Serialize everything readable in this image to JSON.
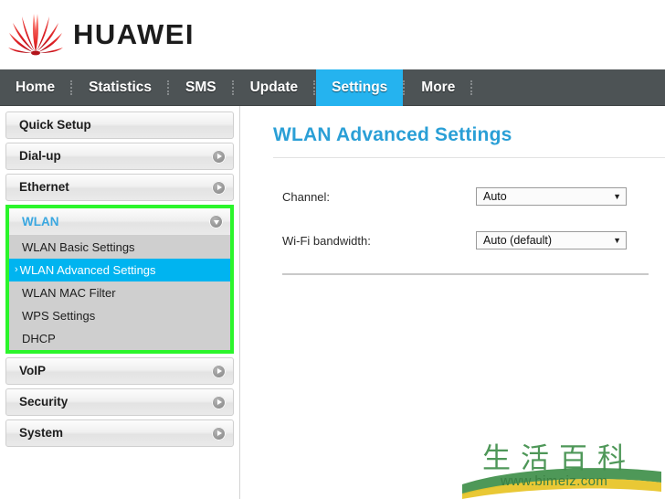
{
  "brand": {
    "name": "HUAWEI",
    "logo_icon": "huawei-flower-logo",
    "logo_color": "#e0131a"
  },
  "nav": {
    "active": "Settings",
    "active_color": "#25b3ef",
    "items": [
      {
        "label": "Home",
        "active": false
      },
      {
        "label": "Statistics",
        "active": false
      },
      {
        "label": "SMS",
        "active": false
      },
      {
        "label": "Update",
        "active": false
      },
      {
        "label": "Settings",
        "active": true
      },
      {
        "label": "More",
        "active": false
      }
    ]
  },
  "sidebar": {
    "highlight_color": "#2bf52b",
    "selected_color": "#00b4f0",
    "items": [
      {
        "label": "Quick Setup",
        "icon": null
      },
      {
        "label": "Dial-up",
        "icon": "chevron-right-icon"
      },
      {
        "label": "Ethernet",
        "icon": "chevron-right-icon"
      }
    ],
    "wlan_group": {
      "label": "WLAN",
      "icon": "chevron-down-icon",
      "expanded": true,
      "highlighted": true,
      "sub_items": [
        {
          "label": "WLAN Basic Settings",
          "selected": false
        },
        {
          "label": "WLAN Advanced Settings",
          "selected": true,
          "marker": "›"
        },
        {
          "label": "WLAN MAC Filter",
          "selected": false
        },
        {
          "label": "WPS Settings",
          "selected": false
        },
        {
          "label": "DHCP",
          "selected": false
        }
      ]
    },
    "items_bottom": [
      {
        "label": "VoIP",
        "icon": "chevron-right-icon"
      },
      {
        "label": "Security",
        "icon": "chevron-right-icon"
      },
      {
        "label": "System",
        "icon": "chevron-right-icon"
      }
    ]
  },
  "main": {
    "title": "WLAN Advanced Settings",
    "title_color": "#2a9fd6",
    "fields": [
      {
        "label": "Channel:",
        "value": "Auto",
        "caret": "▼"
      },
      {
        "label": "Wi-Fi bandwidth:",
        "value": "Auto (default)",
        "caret": "▼"
      }
    ]
  },
  "watermark": {
    "chars": "生活百科",
    "url": "www.bimeiz.com"
  }
}
